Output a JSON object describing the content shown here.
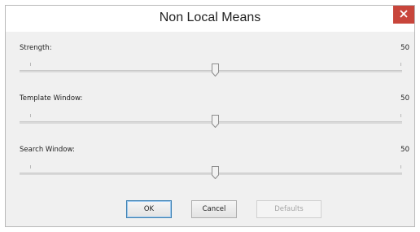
{
  "dialog": {
    "title": "Non Local Means",
    "close_icon": "close-icon"
  },
  "sliders": [
    {
      "label": "Strength:",
      "value": "50",
      "level_percent": 50
    },
    {
      "label": "Template Window:",
      "value": "50",
      "level_percent": 50
    },
    {
      "label": "Search Window:",
      "value": "50",
      "level_percent": 50
    }
  ],
  "buttons": {
    "ok": "OK",
    "cancel": "Cancel",
    "defaults": "Defaults"
  },
  "colors": {
    "close_button": "#c8453b",
    "dialog_background": "#f0f0f0",
    "default_button_border": "#3c7fb1"
  }
}
